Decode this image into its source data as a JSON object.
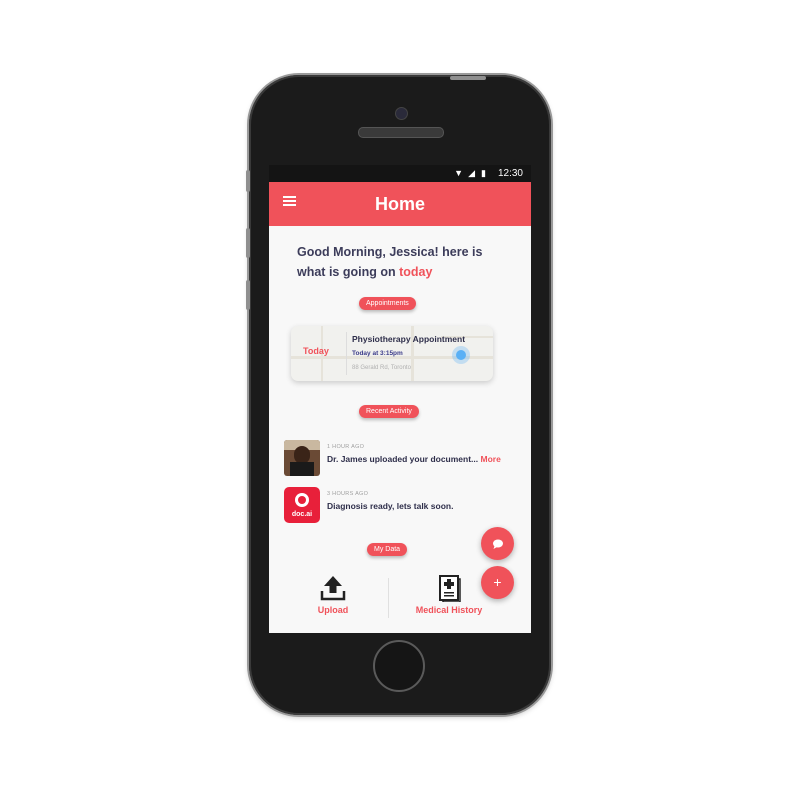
{
  "status_bar": {
    "time": "12:30"
  },
  "app_bar": {
    "title": "Home",
    "menu_icon": "menu-icon"
  },
  "greeting": {
    "text": "Good Morning, Jessica! here is what is going on",
    "highlight": "today"
  },
  "sections": {
    "appointments": "Appointments",
    "recent_activity": "Recent Activity",
    "my_data": "My Data"
  },
  "appointment": {
    "day": "Today",
    "title": "Physiotherapy Appointment",
    "time": "Today at 3:15pm",
    "address": "88 Gerald Rd, Toronto"
  },
  "activity": [
    {
      "ago": "1 HOUR AGO",
      "message": "Dr. James uploaded your document...",
      "more": "More",
      "avatar": "doctor-avatar"
    },
    {
      "ago": "3 HOURS AGO",
      "message": "Diagnosis ready, lets talk soon.",
      "logo_text": "doc.ai"
    }
  ],
  "bottom": [
    {
      "label": "Upload",
      "icon": "upload-icon"
    },
    {
      "label": "Medical History",
      "icon": "medical-history-icon"
    }
  ],
  "colors": {
    "accent": "#f0525a",
    "text_dark": "#3c3c5a"
  }
}
